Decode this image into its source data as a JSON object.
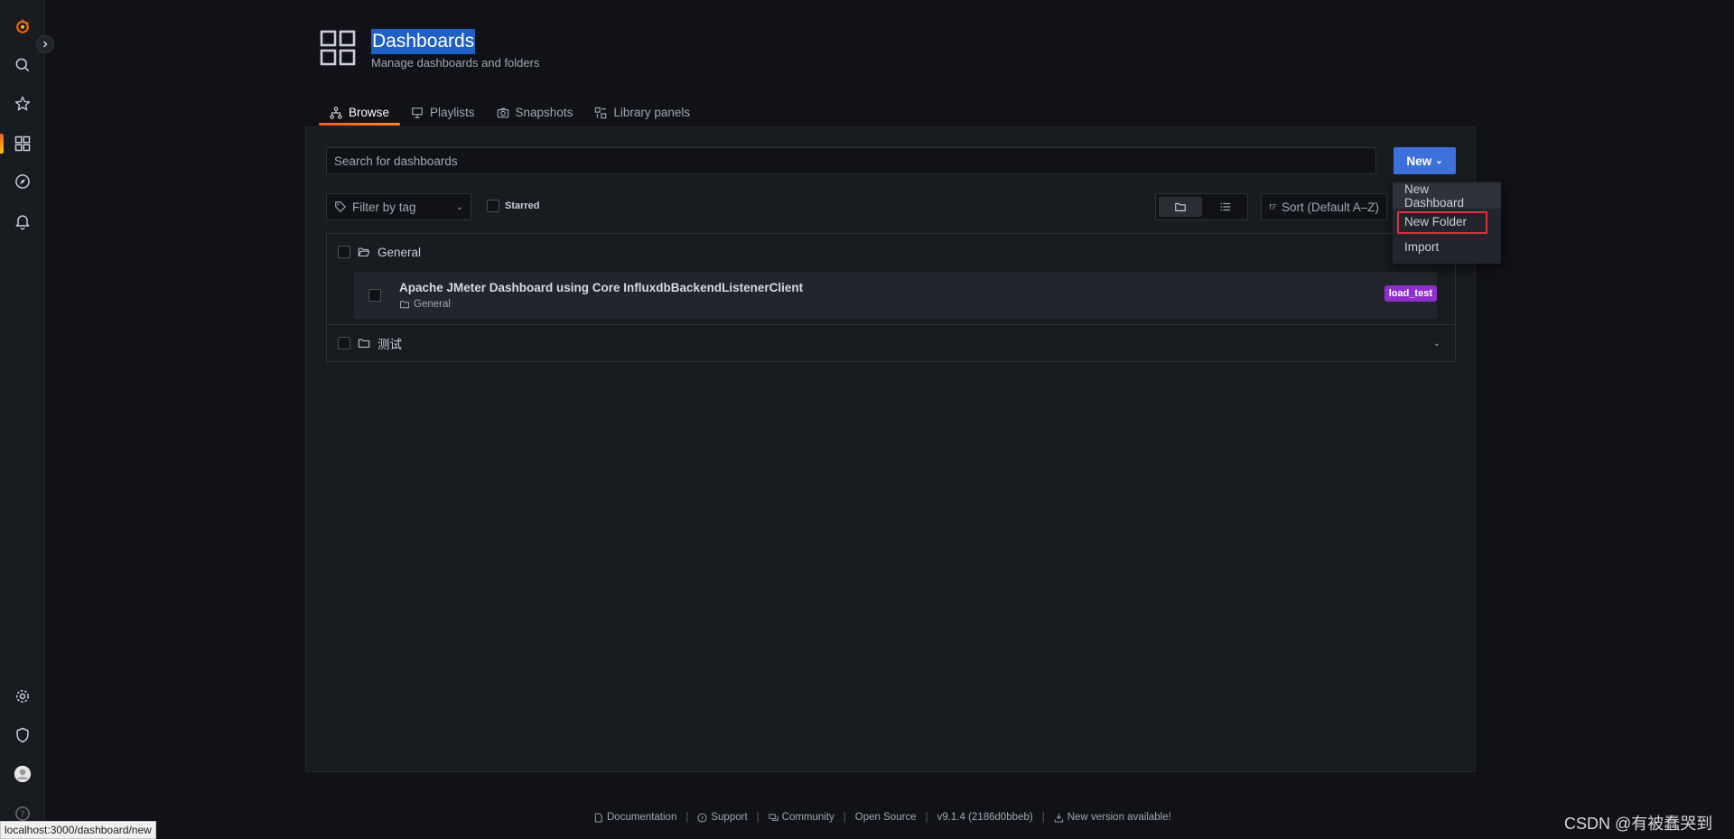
{
  "sidenav": {
    "items": [
      {
        "icon": "grafana-logo-icon"
      },
      {
        "icon": "search-icon"
      },
      {
        "icon": "star-icon"
      },
      {
        "icon": "dashboards-icon"
      },
      {
        "icon": "explore-icon"
      },
      {
        "icon": "alerting-bell-icon"
      },
      {
        "icon": "gear-icon"
      },
      {
        "icon": "shield-icon"
      },
      {
        "icon": "avatar"
      },
      {
        "icon": "help-icon"
      }
    ]
  },
  "header": {
    "title": "Dashboards",
    "subtitle": "Manage dashboards and folders"
  },
  "tabs": [
    {
      "label": "Browse",
      "icon": "sitemap-icon",
      "active": true
    },
    {
      "label": "Playlists",
      "icon": "presentation-icon",
      "active": false
    },
    {
      "label": "Snapshots",
      "icon": "camera-icon",
      "active": false
    },
    {
      "label": "Library panels",
      "icon": "library-panel-icon",
      "active": false
    }
  ],
  "toolbar": {
    "search_placeholder": "Search for dashboards",
    "new_label": "New",
    "filter_tag_placeholder": "Filter by tag",
    "starred_label": "Starred",
    "sort_label": "Sort (Default A–Z)"
  },
  "new_menu": {
    "items": [
      "New Dashboard",
      "New Folder",
      "Import"
    ],
    "highlighted": "New Folder"
  },
  "folders": [
    {
      "name": "General",
      "expanded": true,
      "dashboards": [
        {
          "title": "Apache JMeter Dashboard using Core InfluxdbBackendListenerClient",
          "folder": "General",
          "tags": [
            "load_test"
          ]
        }
      ]
    },
    {
      "name": "测试",
      "expanded": false,
      "dashboards": []
    }
  ],
  "footer": {
    "documentation": "Documentation",
    "support": "Support",
    "community": "Community",
    "open_source": "Open Source",
    "version": "v9.1.4 (2186d0bbeb)",
    "new_version": "New version available!"
  },
  "status_url": "localhost:3000/dashboard/new",
  "watermark": "CSDN @有被蠢哭到",
  "colors": {
    "accent_blue": "#3d71d9",
    "tag_purple": "#8e2ecb",
    "highlight_red": "#e02f44",
    "active_orange": "#f05a28"
  }
}
